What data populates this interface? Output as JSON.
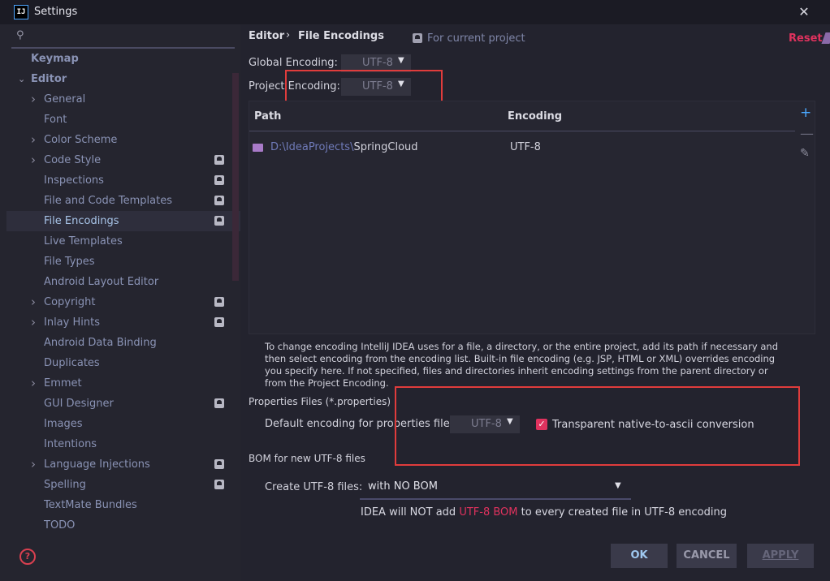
{
  "window": {
    "app_icon_text": "IJ",
    "title": "Settings",
    "close_glyph": "✕"
  },
  "sidebar": {
    "items": [
      {
        "label": "Keymap",
        "type": "section",
        "arrow": "",
        "badge": false
      },
      {
        "label": "Editor",
        "type": "section",
        "arrow": "expanded",
        "badge": false
      },
      {
        "label": "General",
        "arrow": "collapsed",
        "badge": false
      },
      {
        "label": "Font",
        "arrow": "",
        "badge": false
      },
      {
        "label": "Color Scheme",
        "arrow": "collapsed",
        "badge": false
      },
      {
        "label": "Code Style",
        "arrow": "collapsed",
        "badge": true
      },
      {
        "label": "Inspections",
        "arrow": "",
        "badge": true
      },
      {
        "label": "File and Code Templates",
        "arrow": "",
        "badge": true
      },
      {
        "label": "File Encodings",
        "arrow": "",
        "badge": true,
        "selected": true
      },
      {
        "label": "Live Templates",
        "arrow": "",
        "badge": false
      },
      {
        "label": "File Types",
        "arrow": "",
        "badge": false
      },
      {
        "label": "Android Layout Editor",
        "arrow": "",
        "badge": false
      },
      {
        "label": "Copyright",
        "arrow": "collapsed",
        "badge": true
      },
      {
        "label": "Inlay Hints",
        "arrow": "collapsed",
        "badge": true
      },
      {
        "label": "Android Data Binding",
        "arrow": "",
        "badge": false
      },
      {
        "label": "Duplicates",
        "arrow": "",
        "badge": false
      },
      {
        "label": "Emmet",
        "arrow": "collapsed",
        "badge": false
      },
      {
        "label": "GUI Designer",
        "arrow": "",
        "badge": true
      },
      {
        "label": "Images",
        "arrow": "",
        "badge": false
      },
      {
        "label": "Intentions",
        "arrow": "",
        "badge": false
      },
      {
        "label": "Language Injections",
        "arrow": "collapsed",
        "badge": true
      },
      {
        "label": "Spelling",
        "arrow": "",
        "badge": true
      },
      {
        "label": "TextMate Bundles",
        "arrow": "",
        "badge": false
      },
      {
        "label": "TODO",
        "arrow": "",
        "badge": false
      }
    ],
    "help_glyph": "?"
  },
  "header": {
    "breadcrumb_parent": "Editor",
    "breadcrumb_sep": "›",
    "breadcrumb_current": "File Encodings",
    "scope_text": "For current project",
    "reset": "Reset"
  },
  "encodings": {
    "global_label": "Global Encoding:",
    "global_value": "UTF-8",
    "project_label": "Project Encoding:",
    "project_value": "UTF-8"
  },
  "table": {
    "col_path": "Path",
    "col_encoding": "Encoding",
    "rows": [
      {
        "path_prefix": "D:\\IdeaProjects\\",
        "path_name": "SpringCloud",
        "encoding": "UTF-8"
      }
    ],
    "add_glyph": "+",
    "remove_glyph": "—",
    "edit_glyph": "✎"
  },
  "help_text": "To change encoding IntelliJ IDEA uses for a file, a directory, or the entire project, add its path if necessary and then select encoding from the encoding list. Built-in file encoding (e.g. JSP, HTML or XML) overrides encoding you specify here. If not specified, files and directories inherit encoding settings from the parent directory or from the Project Encoding.",
  "properties": {
    "section_title": "Properties Files (*.properties)",
    "default_label": "Default encoding for properties files:",
    "default_value": "UTF-8",
    "native_ascii_label": "Transparent native-to-ascii conversion",
    "native_ascii_checked": true
  },
  "bom": {
    "section_title": "BOM for new UTF-8 files",
    "create_label": "Create UTF-8 files:",
    "create_value": "with NO BOM",
    "note_pre": "IDEA will NOT add ",
    "note_highlight": "UTF-8 BOM",
    "note_post": " to every created file in UTF-8 encoding"
  },
  "buttons": {
    "ok": "OK",
    "cancel": "CANCEL",
    "apply": "APPLY"
  },
  "colors": {
    "accent": "#e0325e",
    "background": "#23232e",
    "highlight_box": "#e03c3c",
    "link_blue": "#4aa8ff"
  }
}
